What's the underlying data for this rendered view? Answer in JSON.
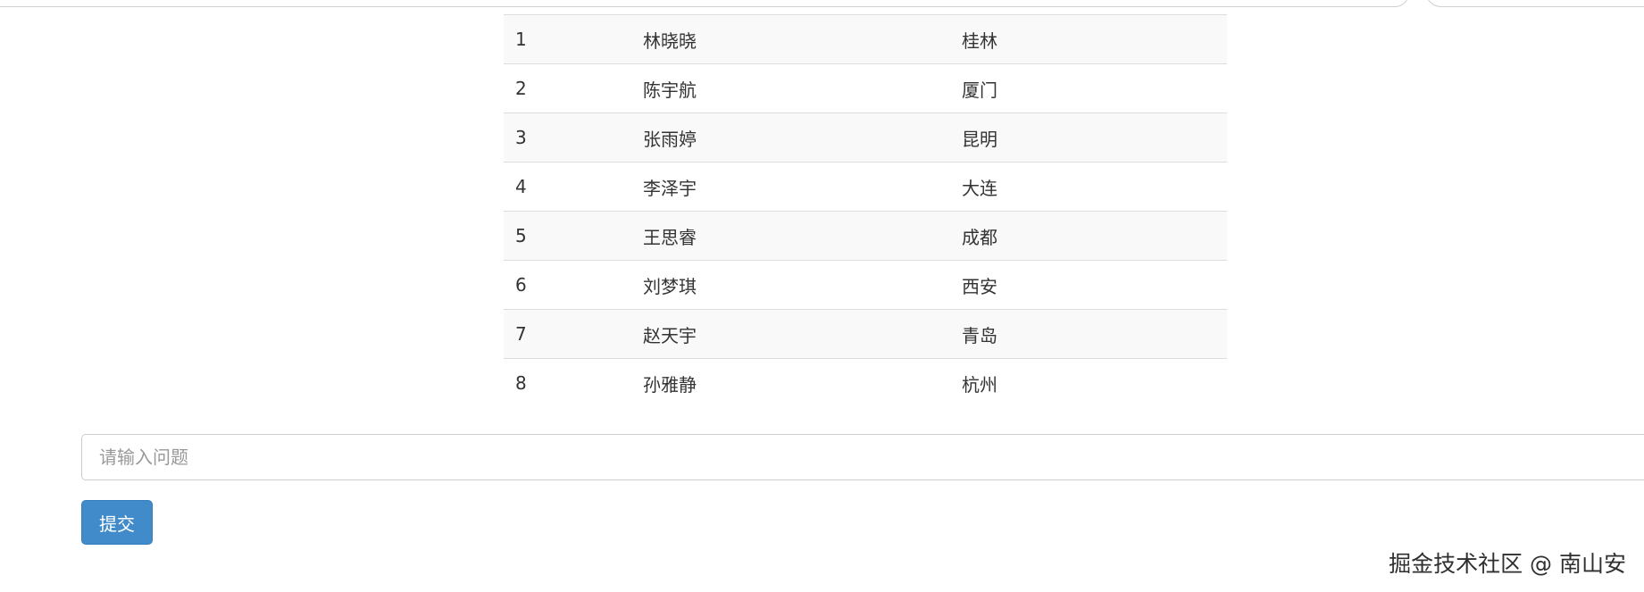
{
  "table": {
    "rows": [
      {
        "id": "1",
        "name": "林晓晓",
        "city": "桂林"
      },
      {
        "id": "2",
        "name": "陈宇航",
        "city": "厦门"
      },
      {
        "id": "3",
        "name": "张雨婷",
        "city": "昆明"
      },
      {
        "id": "4",
        "name": "李泽宇",
        "city": "大连"
      },
      {
        "id": "5",
        "name": "王思睿",
        "city": "成都"
      },
      {
        "id": "6",
        "name": "刘梦琪",
        "city": "西安"
      },
      {
        "id": "7",
        "name": "赵天宇",
        "city": "青岛"
      },
      {
        "id": "8",
        "name": "孙雅静",
        "city": "杭州"
      }
    ]
  },
  "question": {
    "placeholder": "请输入问题",
    "value": ""
  },
  "submit": {
    "label": "提交"
  },
  "watermark": {
    "text": "掘金技术社区 @ 南山安"
  },
  "colors": {
    "primary_button": "#428bca",
    "striped_row": "#f9f9f9",
    "row_border": "#dddddd"
  }
}
